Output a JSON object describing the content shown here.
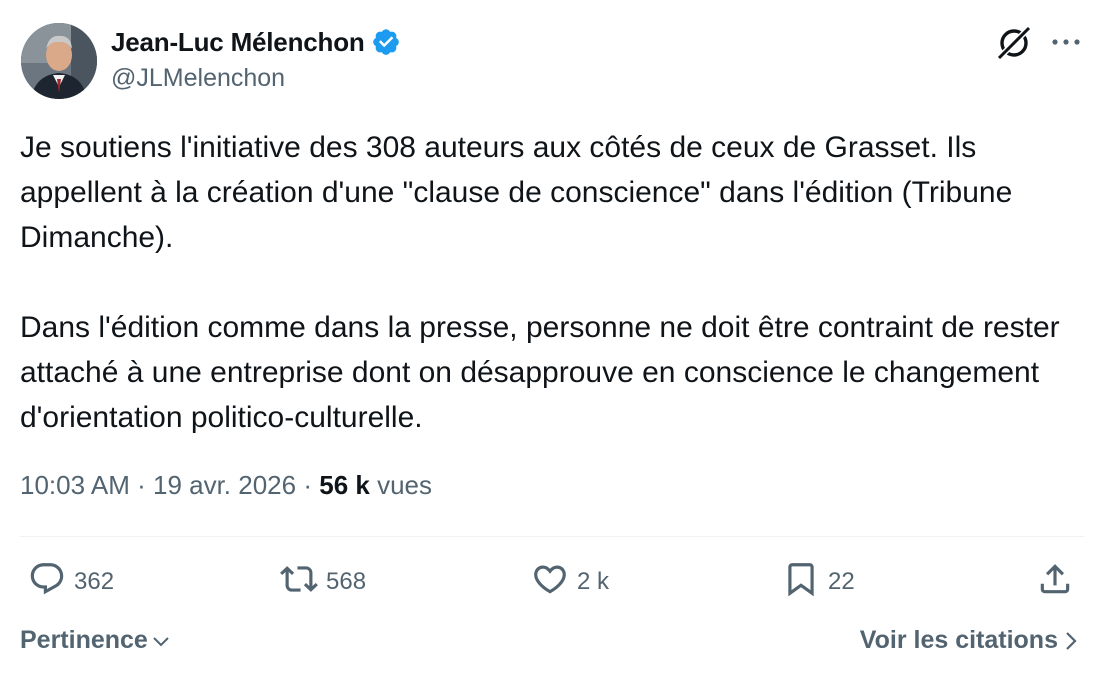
{
  "author": {
    "name": "Jean-Luc Mélenchon",
    "handle": "@JLMelenchon",
    "verified": true,
    "avatar_icon": "profile-photo"
  },
  "post": {
    "paragraphs": [
      "Je soutiens l'initiative des 308 auteurs aux côtés de ceux de Grasset. Ils appellent à la création d'une \"clause de conscience\" dans l'édition (Tribune Dimanche).",
      "Dans l'édition comme dans la presse, personne ne doit être contraint de rester attaché à une entreprise dont on désapprouve en conscience le changement d'orientation politico-culturelle."
    ],
    "time": "10:03 AM",
    "date": "19 avr. 2026",
    "views_count": "56 k",
    "views_label": "vues"
  },
  "actions": {
    "replies": "362",
    "reposts": "568",
    "likes": "2 k",
    "bookmarks": "22"
  },
  "footer": {
    "sort_label": "Pertinence",
    "quotes_label": "Voir les citations"
  },
  "colors": {
    "verified_badge": "#1d9bf0",
    "text_primary": "#0f1419",
    "text_secondary": "#536471"
  }
}
